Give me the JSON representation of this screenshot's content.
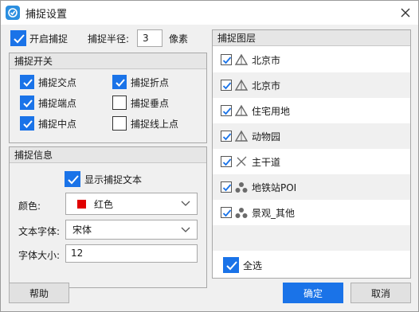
{
  "window": {
    "title": "捕捉设置",
    "close_symbol": "✕"
  },
  "enable_snap": {
    "label": "开启捕捉",
    "checked": true
  },
  "radius": {
    "label": "捕捉半径:",
    "value": "3",
    "unit": "像素"
  },
  "snap_switch": {
    "title": "捕捉开关",
    "items": [
      {
        "label": "捕捉交点",
        "checked": true
      },
      {
        "label": "捕捉折点",
        "checked": true
      },
      {
        "label": "捕捉端点",
        "checked": true
      },
      {
        "label": "捕捉垂点",
        "checked": false
      },
      {
        "label": "捕捉中点",
        "checked": true
      },
      {
        "label": "捕捉线上点",
        "checked": false
      }
    ]
  },
  "snap_info": {
    "title": "捕捉信息",
    "show_text": {
      "label": "显示捕捉文本",
      "checked": true
    },
    "color": {
      "label": "颜色:",
      "value": "红色",
      "swatch": "#e00000"
    },
    "font": {
      "label": "文本字体:",
      "value": "宋体"
    },
    "font_size": {
      "label": "字体大小:",
      "value": "12"
    }
  },
  "layers": {
    "title": "捕捉图层",
    "items": [
      {
        "name": "北京市",
        "icon": "polygon-icon",
        "checked": true
      },
      {
        "name": "北京市",
        "icon": "polygon-icon",
        "checked": true
      },
      {
        "name": "住宅用地",
        "icon": "polygon-icon",
        "checked": true
      },
      {
        "name": "动物园",
        "icon": "polygon-icon",
        "checked": true
      },
      {
        "name": "主干道",
        "icon": "line-icon",
        "checked": true
      },
      {
        "name": "地铁站POI",
        "icon": "point-icon",
        "checked": true
      },
      {
        "name": "景观_其他",
        "icon": "point-icon",
        "checked": true
      }
    ],
    "select_all": {
      "label": "全选",
      "checked": true
    }
  },
  "buttons": {
    "help": "帮助",
    "ok": "确定",
    "cancel": "取消"
  },
  "colors": {
    "accent": "#1a73e8",
    "icon_gray": "#6b6b6b"
  }
}
